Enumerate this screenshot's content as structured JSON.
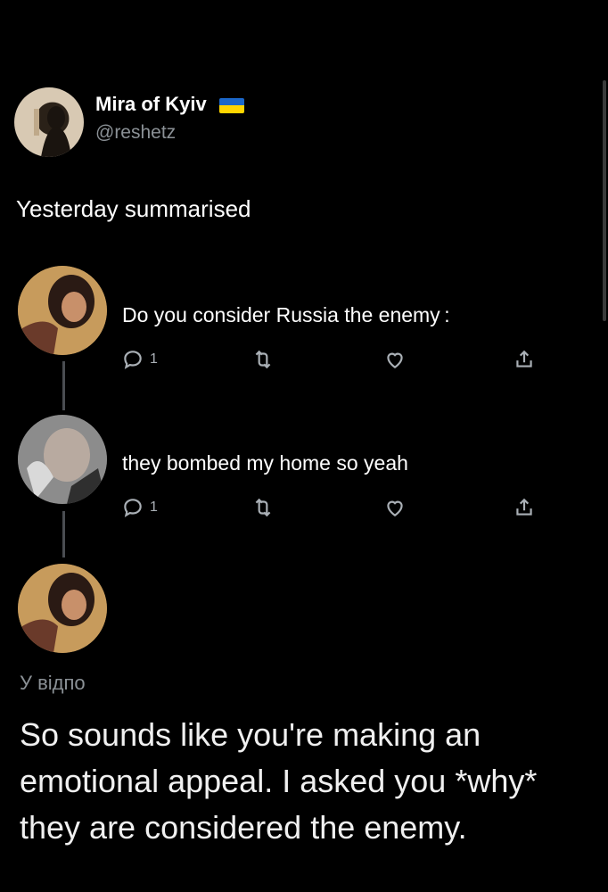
{
  "post": {
    "display_name": "Mira of Kyiv",
    "handle": "@reshetz",
    "text": "Yesterday summarised"
  },
  "thread": [
    {
      "text": "Do you consider Russia the enemy :",
      "replies": "1"
    },
    {
      "text": "they bombed my home so yeah",
      "replies": "1"
    }
  ],
  "reply": {
    "context": "У відпо",
    "text": "So sounds like you're making an emotional appeal. I asked you *why* they are considered the enemy."
  },
  "icons": [
    "reply-icon",
    "retweet-icon",
    "like-icon",
    "share-icon"
  ],
  "colors": {
    "flag_blue": "#1b67c9",
    "flag_yellow": "#ffd500",
    "background": "#000000"
  }
}
